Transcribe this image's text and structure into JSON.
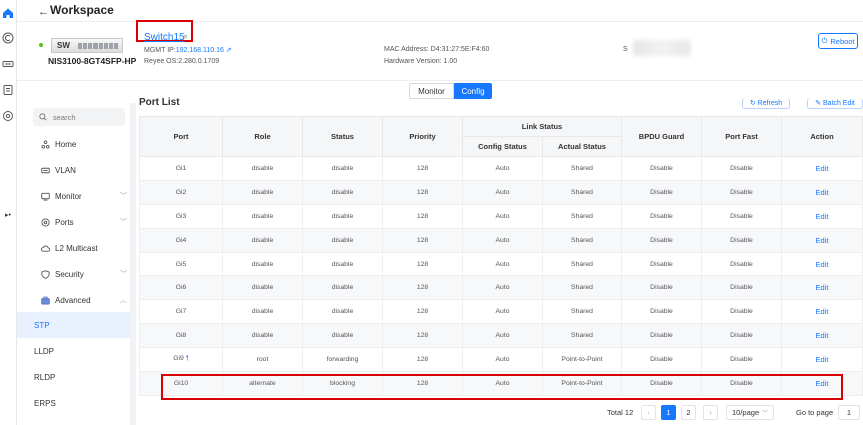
{
  "header": {
    "title": "Workspace",
    "back_label": "←"
  },
  "device": {
    "badge": "SW",
    "model": "NIS3100-8GT4SFP-HP",
    "name": "Switch15",
    "mgmt_label": "MGMT IP:",
    "mgmt_ip": "192.168.110.16",
    "os": "Reyee OS:2.280.0.1709",
    "mac": "MAC Address: D4:31:27:5E:F4:60",
    "hardware": "Hardware Version: 1.00",
    "sn_label": "S",
    "reboot_label": "Reboot"
  },
  "tabs": {
    "monitor": "Monitor",
    "config": "Config"
  },
  "sidebar": {
    "search_placeholder": "search",
    "items": [
      {
        "label": "Home",
        "icon": "home-icon"
      },
      {
        "label": "VLAN",
        "icon": "vlan-icon"
      },
      {
        "label": "Monitor",
        "icon": "monitor-icon"
      },
      {
        "label": "Ports",
        "icon": "ports-icon"
      },
      {
        "label": "L2 Multicast",
        "icon": "cloud-icon"
      },
      {
        "label": "Security",
        "icon": "shield-icon"
      },
      {
        "label": "Advanced",
        "icon": "briefcase-icon"
      }
    ],
    "sub_items": [
      "STP",
      "LLDP",
      "RLDP",
      "ERPS"
    ],
    "active_sub": "STP"
  },
  "port_list": {
    "title": "Port List",
    "refresh_label": "Refresh",
    "batch_label": "Batch Edit",
    "headers": {
      "port": "Port",
      "role": "Role",
      "status": "Status",
      "priority": "Priority",
      "link_status": "Link Status",
      "config_status": "Config Status",
      "actual_status": "Actual Status",
      "bpdu_guard": "BPDU Guard",
      "port_fast": "Port Fast",
      "action": "Action"
    },
    "rows": [
      [
        "Gi1",
        "disable",
        "disable",
        "128",
        "Auto",
        "Shared",
        "Disable",
        "Disable",
        "Edit"
      ],
      [
        "Gi2",
        "disable",
        "disable",
        "128",
        "Auto",
        "Shared",
        "Disable",
        "Disable",
        "Edit"
      ],
      [
        "Gi3",
        "disable",
        "disable",
        "128",
        "Auto",
        "Shared",
        "Disable",
        "Disable",
        "Edit"
      ],
      [
        "Gi4",
        "disable",
        "disable",
        "128",
        "Auto",
        "Shared",
        "Disable",
        "Disable",
        "Edit"
      ],
      [
        "Gi5",
        "disable",
        "disable",
        "128",
        "Auto",
        "Shared",
        "Disable",
        "Disable",
        "Edit"
      ],
      [
        "Gi6",
        "disable",
        "disable",
        "128",
        "Auto",
        "Shared",
        "Disable",
        "Disable",
        "Edit"
      ],
      [
        "Gi7",
        "disable",
        "disable",
        "128",
        "Auto",
        "Shared",
        "Disable",
        "Disable",
        "Edit"
      ],
      [
        "Gi8",
        "disable",
        "disable",
        "128",
        "Auto",
        "Shared",
        "Disable",
        "Disable",
        "Edit"
      ],
      [
        "Gi9",
        "root",
        "forwarding",
        "128",
        "Auto",
        "Point-to-Point",
        "Disable",
        "Disable",
        "Edit"
      ],
      [
        "Gi10",
        "alternate",
        "blocking",
        "128",
        "Auto",
        "Point-to-Point",
        "Disable",
        "Disable",
        "Edit"
      ]
    ],
    "uplink_row": "Gi9",
    "highlighted_row": "Gi10"
  },
  "pagination": {
    "total": "Total 12",
    "pages": [
      "1",
      "2"
    ],
    "current": "1",
    "page_size": "10/page",
    "goto_label": "Go to page",
    "goto_value": "1"
  },
  "colors": {
    "accent": "#1677ff",
    "highlight": "#d90000",
    "online": "#52c41a"
  }
}
